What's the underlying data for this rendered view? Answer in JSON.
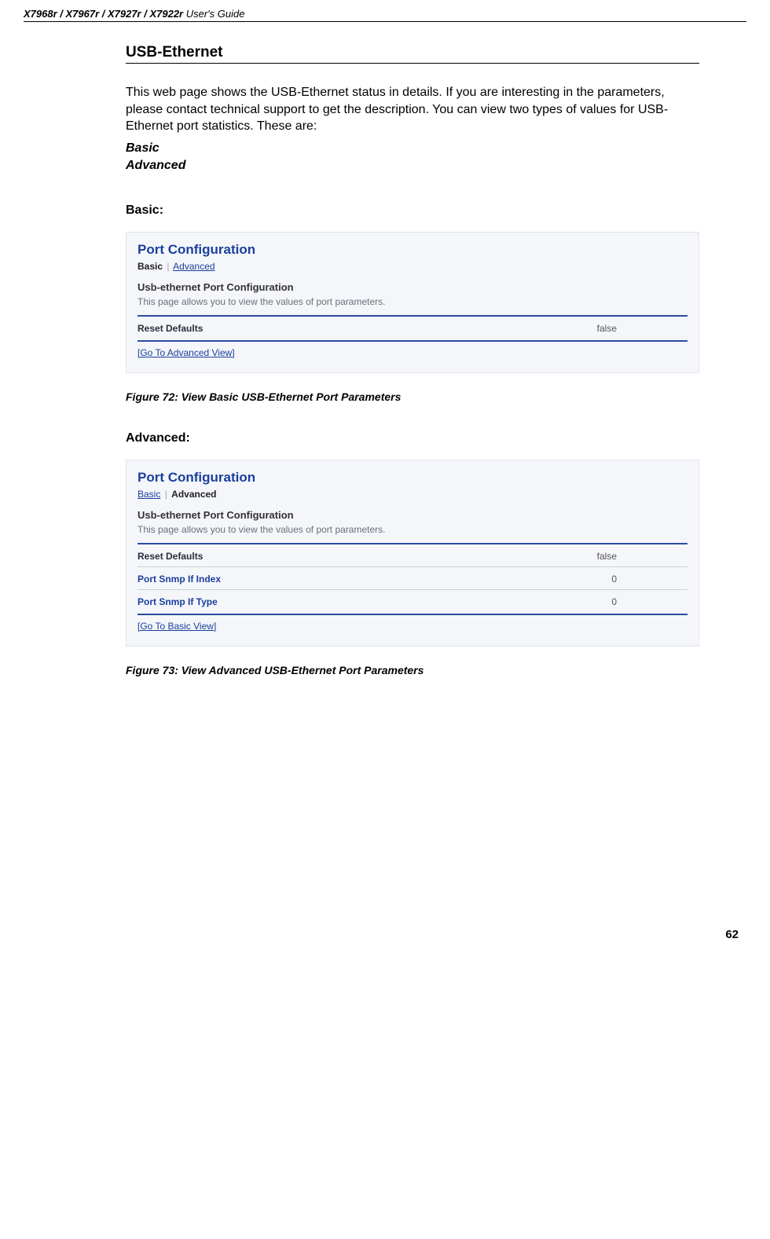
{
  "header": {
    "models": "X7968r / X7967r / X7927r / X7922r",
    "suffix": " User's Guide"
  },
  "section_title": "USB-Ethernet",
  "intro": "This web page shows the USB-Ethernet status in details. If you are interesting in the parameters, please contact technical support to get the description. You can view two types of values for USB-Ethernet port statistics. These are:",
  "types": {
    "basic": "Basic",
    "advanced": "Advanced"
  },
  "basic": {
    "heading": "Basic:",
    "panel": {
      "title": "Port Configuration",
      "tab_active": "Basic",
      "tab_link": "Advanced",
      "subtitle": "Usb-ethernet Port Configuration",
      "desc": "This page allows you to view the values of port parameters.",
      "rows": [
        {
          "label": "Reset Defaults",
          "value": "false"
        }
      ],
      "goto": "[Go To Advanced View]"
    },
    "caption": "Figure 72: View Basic USB-Ethernet Port Parameters"
  },
  "advanced": {
    "heading": "Advanced:",
    "panel": {
      "title": "Port Configuration",
      "tab_link": "Basic",
      "tab_active": "Advanced",
      "subtitle": "Usb-ethernet Port Configuration",
      "desc": "This page allows you to view the values of port parameters.",
      "rows": [
        {
          "label": "Reset Defaults",
          "value": "false"
        },
        {
          "label": "Port Snmp If Index",
          "value": "0"
        },
        {
          "label": "Port Snmp If Type",
          "value": "0"
        }
      ],
      "goto": "[Go To Basic View]"
    },
    "caption": "Figure 73: View Advanced USB-Ethernet Port Parameters"
  },
  "page_number": "62"
}
